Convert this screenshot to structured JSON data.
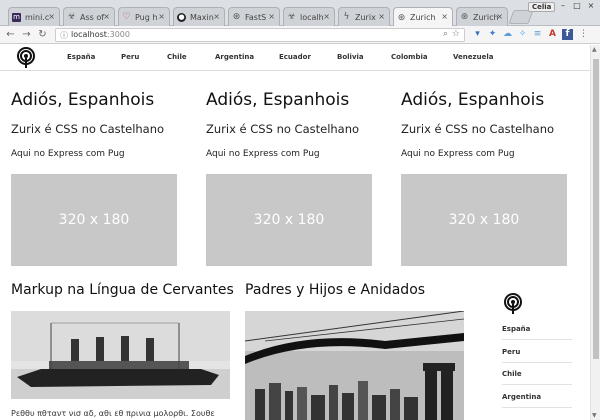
{
  "browser": {
    "user": "Celia",
    "tabs": [
      {
        "title": "mini.c",
        "icon": "m-logo-icon"
      },
      {
        "title": "Ass of",
        "icon": "biohazard-icon"
      },
      {
        "title": "Pug h",
        "icon": "heart-icon"
      },
      {
        "title": "Maxin",
        "icon": "github-icon"
      },
      {
        "title": "FastS",
        "icon": "globe-icon"
      },
      {
        "title": "localh",
        "icon": "biohazard-icon"
      },
      {
        "title": "Zurix",
        "icon": "bolt-icon"
      },
      {
        "title": "Zurich",
        "icon": "globe-icon"
      },
      {
        "title": "Zurich",
        "icon": "globe-icon"
      }
    ],
    "active_tab": 7,
    "url_host": "localhost",
    "url_port": ":3000"
  },
  "page": {
    "nav": [
      "España",
      "Peru",
      "Chile",
      "Argentina",
      "Ecuador",
      "Bolivia",
      "Colombia",
      "Venezuela"
    ],
    "columns": [
      {
        "title": "Adiós, Espanhois",
        "subtitle": "Zurix é CSS no Castelhano",
        "text": "Aqui no Express com Pug",
        "image_label": "320 x 180"
      },
      {
        "title": "Adiós, Espanhois",
        "subtitle": "Zurix é CSS no Castelhano",
        "text": "Aqui no Express com Pug",
        "image_label": "320 x 180"
      },
      {
        "title": "Adiós, Espanhois",
        "subtitle": "Zurix é CSS no Castelhano",
        "text": "Aqui no Express com Pug",
        "image_label": "320 x 180"
      }
    ],
    "section_left": {
      "heading": "Markup na Língua de Cervantes",
      "caption": "Ρεθθυ πθταντ νισ αδ, αθι εθ πρινια μολορθι. Σουθε"
    },
    "section_right": {
      "heading": "Padres y Hijos e Anidados"
    },
    "sidebar": [
      "España",
      "Peru",
      "Chile",
      "Argentina"
    ]
  },
  "colors": {
    "placeholder": "#c8c8c8",
    "text": "#111111"
  }
}
